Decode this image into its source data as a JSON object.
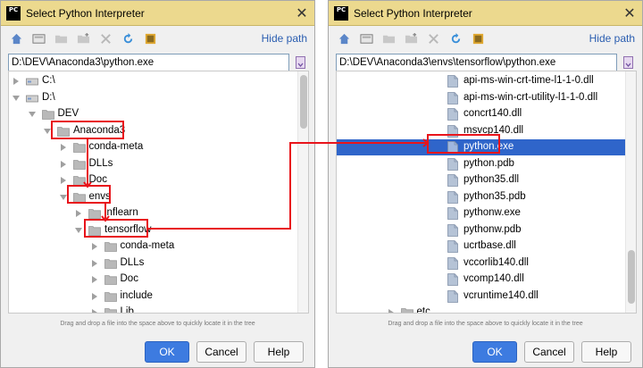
{
  "left": {
    "title": "Select Python Interpreter",
    "logo": "PC",
    "hide_path": "Hide path",
    "path_value": "D:\\DEV\\Anaconda3\\python.exe",
    "hint": "Drag and drop a file into the space above to quickly locate it in the tree",
    "ok": "OK",
    "cancel": "Cancel",
    "help": "Help",
    "tree": [
      {
        "label": "C:\\",
        "indent": 0,
        "expander": "right",
        "icon": "drive-icon"
      },
      {
        "label": "D:\\",
        "indent": 0,
        "expander": "down",
        "icon": "drive-icon"
      },
      {
        "label": "DEV",
        "indent": 1,
        "expander": "down",
        "icon": "folder-icon"
      },
      {
        "label": "Anaconda3",
        "indent": 2,
        "expander": "down",
        "icon": "folder-icon"
      },
      {
        "label": "conda-meta",
        "indent": 3,
        "expander": "right",
        "icon": "folder-icon"
      },
      {
        "label": "DLLs",
        "indent": 3,
        "expander": "right",
        "icon": "folder-icon"
      },
      {
        "label": "Doc",
        "indent": 3,
        "expander": "right",
        "icon": "folder-icon"
      },
      {
        "label": "envs",
        "indent": 3,
        "expander": "down",
        "icon": "folder-icon"
      },
      {
        "label": "inflearn",
        "indent": 4,
        "expander": "right",
        "icon": "folder-icon"
      },
      {
        "label": "tensorflow",
        "indent": 4,
        "expander": "down",
        "icon": "folder-icon"
      },
      {
        "label": "conda-meta",
        "indent": 5,
        "expander": "right",
        "icon": "folder-icon"
      },
      {
        "label": "DLLs",
        "indent": 5,
        "expander": "right",
        "icon": "folder-icon"
      },
      {
        "label": "Doc",
        "indent": 5,
        "expander": "right",
        "icon": "folder-icon"
      },
      {
        "label": "include",
        "indent": 5,
        "expander": "right",
        "icon": "folder-icon"
      },
      {
        "label": "Lib",
        "indent": 5,
        "expander": "right",
        "icon": "folder-icon"
      }
    ]
  },
  "right": {
    "title": "Select Python Interpreter",
    "logo": "PC",
    "hide_path": "Hide path",
    "path_value": "D:\\DEV\\Anaconda3\\envs\\tensorflow\\python.exe",
    "hint": "Drag and drop a file into the space above to quickly locate it in the tree",
    "ok": "OK",
    "cancel": "Cancel",
    "help": "Help",
    "tree": [
      {
        "label": "api-ms-win-crt-time-l1-1-0.dll",
        "indent": 6,
        "expander": "none",
        "icon": "file-icon"
      },
      {
        "label": "api-ms-win-crt-utility-l1-1-0.dll",
        "indent": 6,
        "expander": "none",
        "icon": "file-icon"
      },
      {
        "label": "concrt140.dll",
        "indent": 6,
        "expander": "none",
        "icon": "file-icon"
      },
      {
        "label": "msvcp140.dll",
        "indent": 6,
        "expander": "none",
        "icon": "file-icon"
      },
      {
        "label": "python.exe",
        "indent": 6,
        "expander": "none",
        "icon": "file-icon",
        "selected": true
      },
      {
        "label": "python.pdb",
        "indent": 6,
        "expander": "none",
        "icon": "file-icon"
      },
      {
        "label": "python35.dll",
        "indent": 6,
        "expander": "none",
        "icon": "file-icon"
      },
      {
        "label": "python35.pdb",
        "indent": 6,
        "expander": "none",
        "icon": "file-icon"
      },
      {
        "label": "pythonw.exe",
        "indent": 6,
        "expander": "none",
        "icon": "file-icon"
      },
      {
        "label": "pythonw.pdb",
        "indent": 6,
        "expander": "none",
        "icon": "file-icon"
      },
      {
        "label": "ucrtbase.dll",
        "indent": 6,
        "expander": "none",
        "icon": "file-icon"
      },
      {
        "label": "vccorlib140.dll",
        "indent": 6,
        "expander": "none",
        "icon": "file-icon"
      },
      {
        "label": "vcomp140.dll",
        "indent": 6,
        "expander": "none",
        "icon": "file-icon"
      },
      {
        "label": "vcruntime140.dll",
        "indent": 6,
        "expander": "none",
        "icon": "file-icon"
      },
      {
        "label": "etc",
        "indent": 3,
        "expander": "right",
        "icon": "folder-icon"
      }
    ]
  },
  "colors": {
    "titlebar": "#ecd98e",
    "selection": "#2f65ca",
    "highlight": "#e8141b",
    "primary_button": "#3d7be0",
    "link": "#2a5db0"
  }
}
